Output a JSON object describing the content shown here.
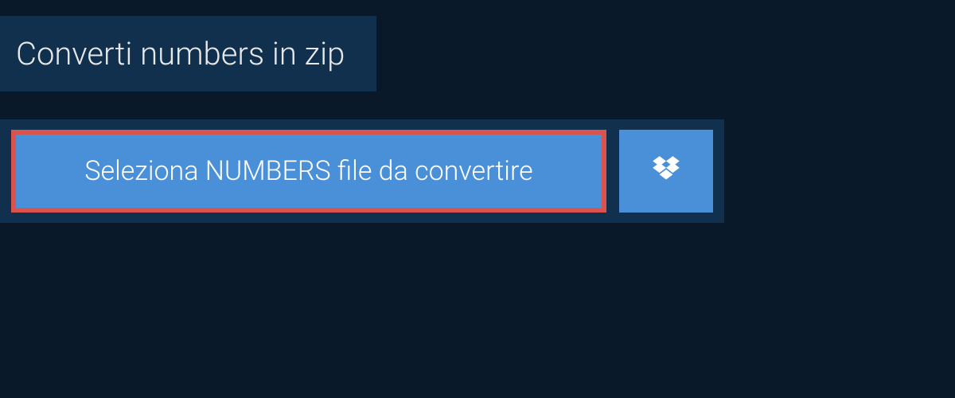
{
  "header": {
    "title": "Converti numbers in zip"
  },
  "upload": {
    "select_label": "Seleziona NUMBERS file da convertire",
    "dropbox_icon": "dropbox-icon"
  },
  "colors": {
    "background": "#0a1929",
    "panel": "#10304d",
    "button": "#4a90d9",
    "highlight_border": "#d9534f",
    "text_light": "#e8e8e8",
    "text_white": "#ffffff"
  }
}
